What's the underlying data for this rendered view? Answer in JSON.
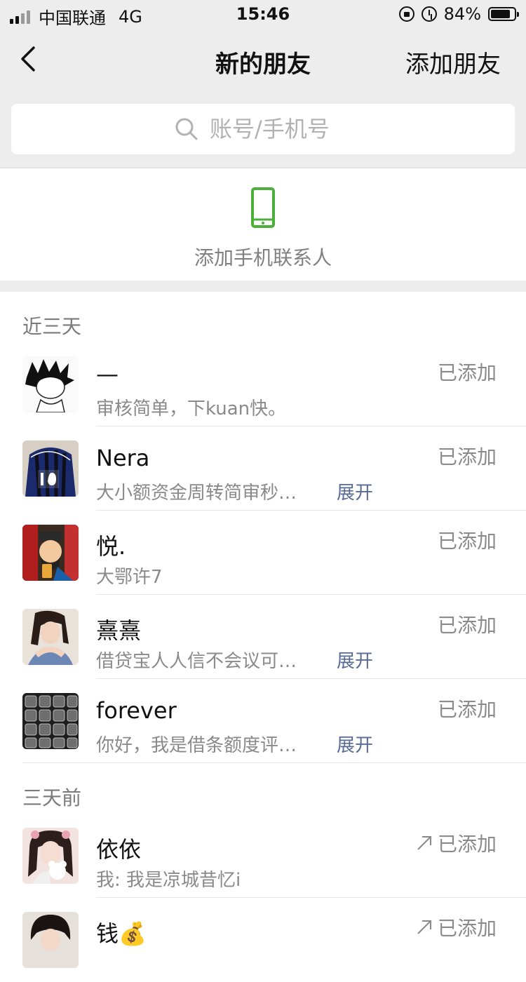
{
  "status_bar": {
    "carrier": "中国联通",
    "network": "4G",
    "time": "15:46",
    "battery_text": "84%",
    "battery_level": 0.84
  },
  "nav": {
    "title": "新的朋友",
    "action": "添加朋友"
  },
  "search": {
    "placeholder": "账号/手机号"
  },
  "add_phone": {
    "label": "添加手机联系人",
    "icon_color": "#4caf3a"
  },
  "sections": [
    {
      "title": "近三天",
      "rows": [
        {
          "name": "—",
          "message": "审核简单，下kuan快。",
          "status": "已添加",
          "expand": ""
        },
        {
          "name": "Nera",
          "message": "大小额资金周转简审秒…",
          "status": "已添加",
          "expand": "展开"
        },
        {
          "name": "悦.",
          "message": "大鄂许7",
          "status": "已添加",
          "expand": ""
        },
        {
          "name": "熹熹",
          "message": "借贷宝人人信不会议可…",
          "status": "已添加",
          "expand": "展开"
        },
        {
          "name": "forever",
          "message": "你好，我是借条额度评…",
          "status": "已添加",
          "expand": "展开"
        }
      ]
    },
    {
      "title": "三天前",
      "rows": [
        {
          "name": "依依",
          "message": "我: 我是凉城昔忆i",
          "status": "已添加",
          "expand": ""
        },
        {
          "name": "钱💰",
          "message": "",
          "status": "已添加",
          "expand": ""
        }
      ]
    }
  ],
  "colors": {
    "link": "#576b95",
    "background": "#ededed"
  }
}
